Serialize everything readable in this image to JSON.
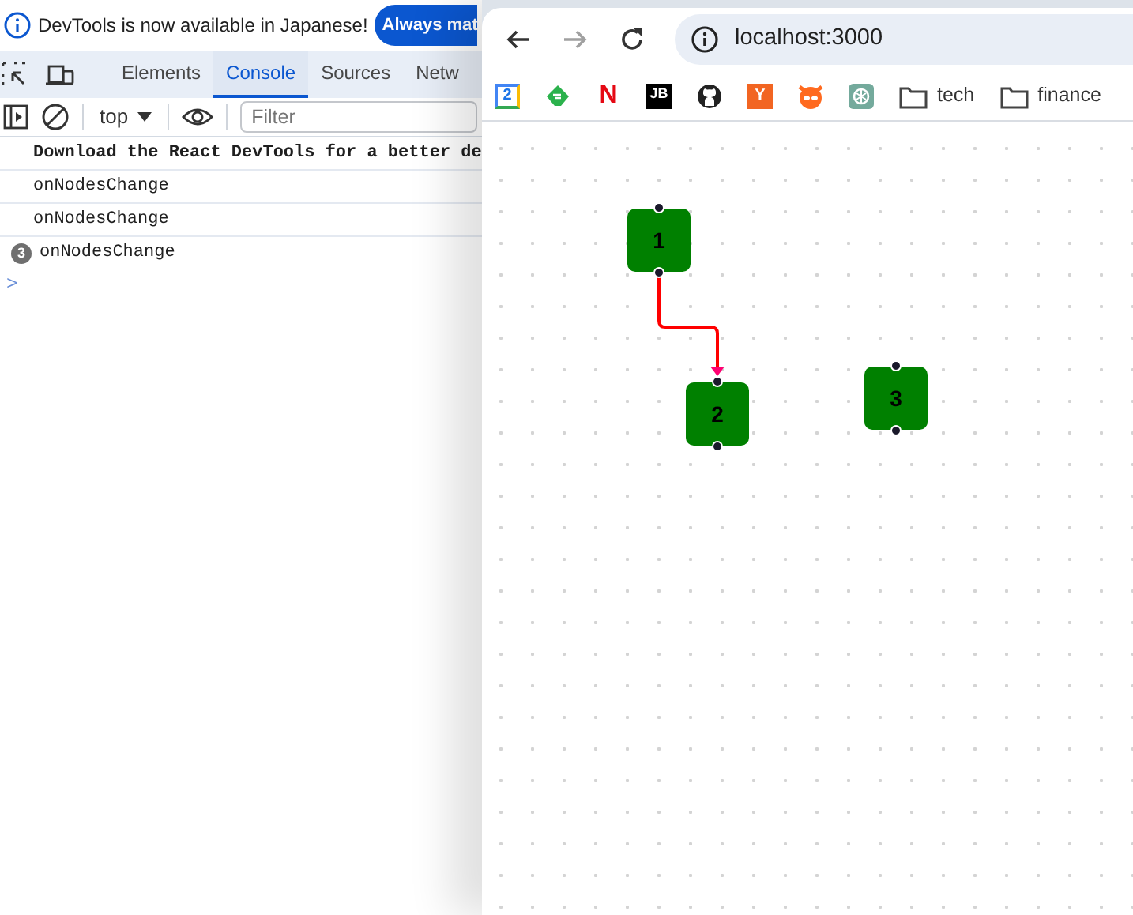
{
  "devtools": {
    "infobar": {
      "message": "DevTools is now available in Japanese!",
      "button": "Always mat"
    },
    "tabs": [
      {
        "label": "Elements",
        "selected": false
      },
      {
        "label": "Console",
        "selected": true
      },
      {
        "label": "Sources",
        "selected": false
      },
      {
        "label": "Netw",
        "selected": false
      }
    ],
    "toolbar": {
      "context": "top",
      "filter_placeholder": "Filter"
    },
    "messages": [
      {
        "text": "Download the React DevTools for a better de",
        "bold": true
      },
      {
        "text": "onNodesChange",
        "bold": false
      },
      {
        "text": "onNodesChange",
        "bold": false
      },
      {
        "text": "onNodesChange",
        "bold": false,
        "count": "3"
      }
    ],
    "prompt": ">"
  },
  "browser": {
    "address": "localhost:3000",
    "back_disabled": false,
    "forward_disabled": true,
    "bookmarks": [
      {
        "kind": "calendar",
        "label": "2"
      },
      {
        "kind": "feedly"
      },
      {
        "kind": "netflix",
        "label": "N"
      },
      {
        "kind": "jetbrains",
        "label": "JB"
      },
      {
        "kind": "github"
      },
      {
        "kind": "ycombinator",
        "label": "Y"
      },
      {
        "kind": "fox"
      },
      {
        "kind": "chatgpt"
      },
      {
        "kind": "folder",
        "label": "tech"
      },
      {
        "kind": "folder",
        "label": "finance"
      }
    ],
    "flow": {
      "nodes": [
        {
          "label": "1"
        },
        {
          "label": "2"
        },
        {
          "label": "3"
        }
      ],
      "edges": [
        {
          "color": "#ff0000"
        }
      ]
    }
  }
}
